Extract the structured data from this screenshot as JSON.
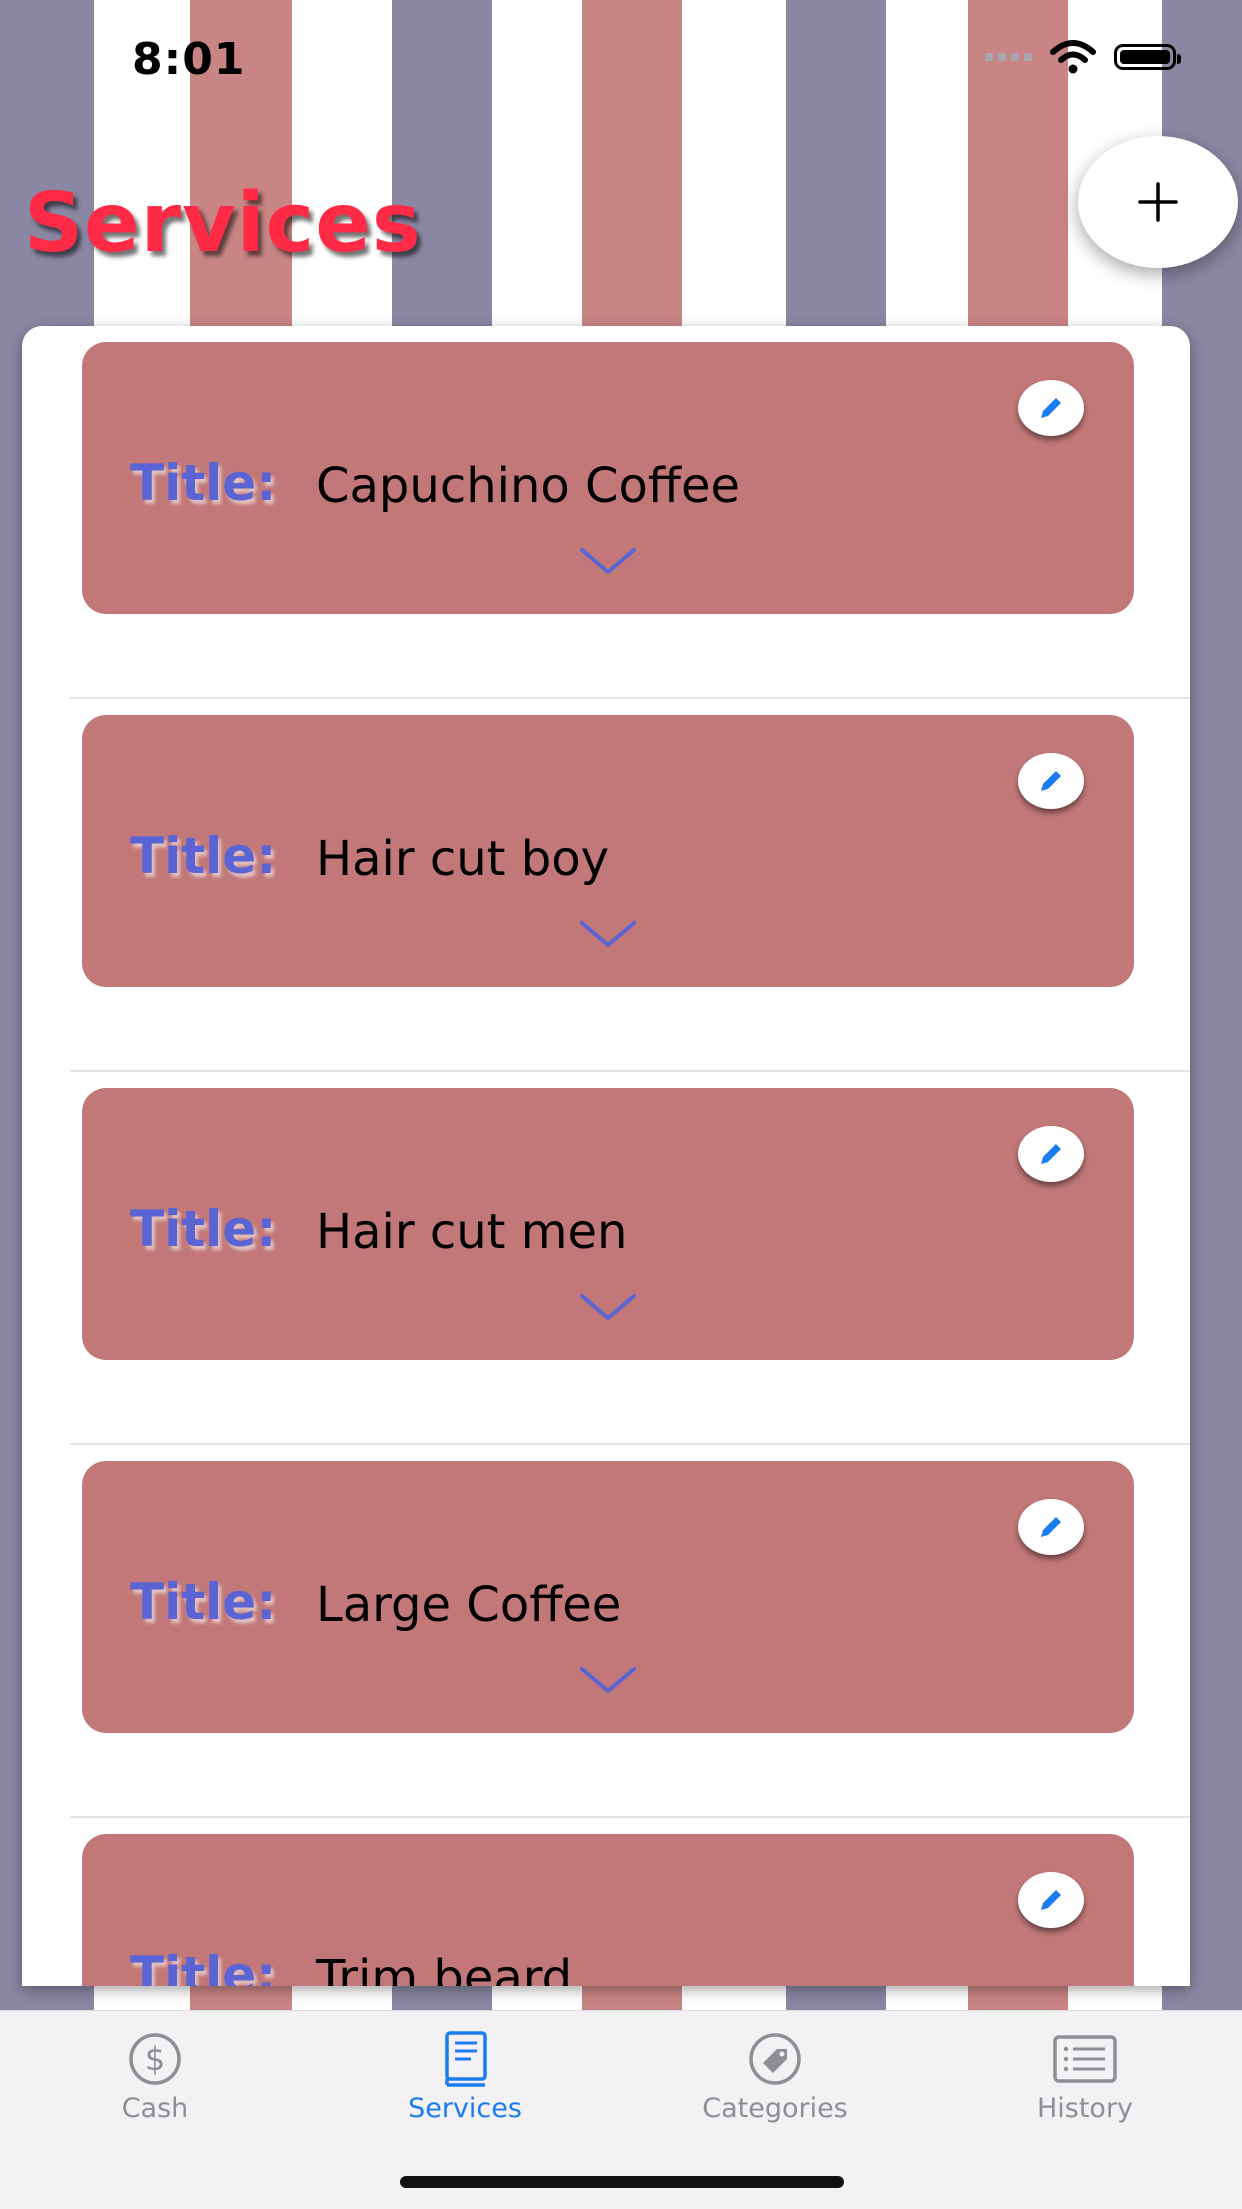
{
  "status_bar": {
    "time": "8:01"
  },
  "header": {
    "title": "Services"
  },
  "colors": {
    "stripe_purple": "#8a87a3",
    "stripe_rose": "#c98584",
    "card_background": "#c27878",
    "title_label": "#5a64d4",
    "page_title": "#ff2a45",
    "tab_active": "#1b7cf0",
    "tab_inactive": "#8e8e93"
  },
  "services": [
    {
      "label": "Title:",
      "value": "Capuchino Coffee"
    },
    {
      "label": "Title:",
      "value": "Hair cut boy"
    },
    {
      "label": "Title:",
      "value": "Hair cut men"
    },
    {
      "label": "Title:",
      "value": "Large Coffee"
    },
    {
      "label": "Title:",
      "value": "Trim beard"
    }
  ],
  "tab_bar": {
    "tabs": [
      {
        "label": "Cash",
        "icon": "dollar-circle-icon"
      },
      {
        "label": "Services",
        "icon": "book-icon",
        "active": true
      },
      {
        "label": "Categories",
        "icon": "tag-icon"
      },
      {
        "label": "History",
        "icon": "list-icon"
      }
    ]
  }
}
